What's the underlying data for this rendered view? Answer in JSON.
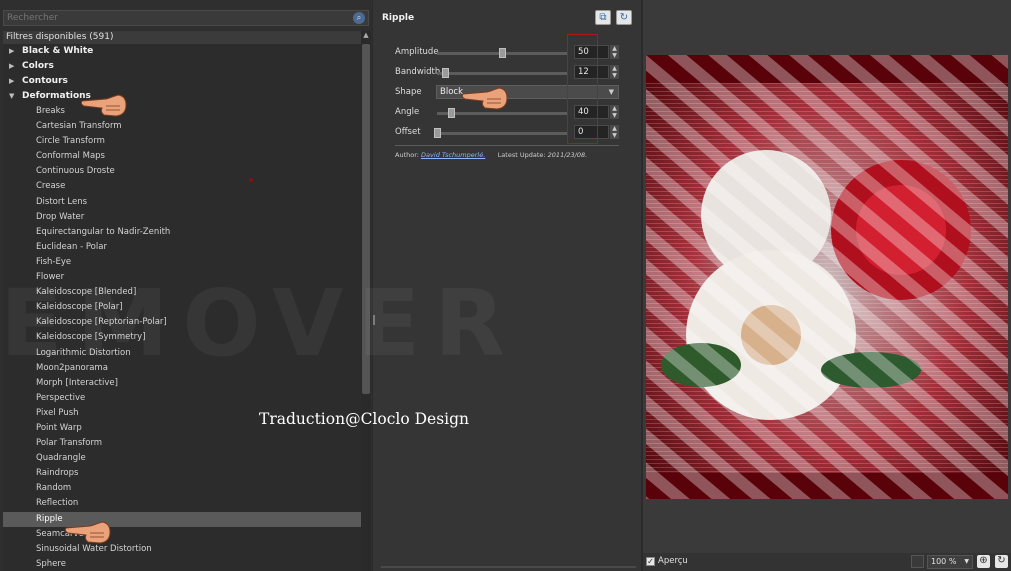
{
  "search": {
    "placeholder": "Rechercher"
  },
  "list": {
    "header": "Filtres disponibles (591)",
    "categories": [
      {
        "label": "Black & White",
        "expanded": false
      },
      {
        "label": "Colors",
        "expanded": false
      },
      {
        "label": "Contours",
        "expanded": false
      },
      {
        "label": "Deformations",
        "expanded": true
      }
    ],
    "items": [
      "Breaks",
      "Cartesian Transform",
      "Circle Transform",
      "Conformal Maps",
      "Continuous Droste",
      "Crease",
      "Distort Lens",
      "Drop Water",
      "Equirectangular to Nadir-Zenith",
      "Euclidean - Polar",
      "Fish-Eye",
      "Flower",
      "Kaleidoscope [Blended]",
      "Kaleidoscope [Polar]",
      "Kaleidoscope [Reptorian-Polar]",
      "Kaleidoscope [Symmetry]",
      "Logarithmic Distortion",
      "Moon2panorama",
      "Morph [Interactive]",
      "Perspective",
      "Pixel Push",
      "Point Warp",
      "Polar Transform",
      "Quadrangle",
      "Raindrops",
      "Random",
      "Reflection",
      "Ripple",
      "Seamcarve",
      "Sinusoidal Water Distortion",
      "Sphere"
    ],
    "selected": "Ripple"
  },
  "filter": {
    "title": "Ripple",
    "params": [
      {
        "label": "Amplitude",
        "value": "50",
        "level": 0.5
      },
      {
        "label": "Bandwidth",
        "value": "12",
        "level": 0.06
      },
      {
        "label": "Angle",
        "value": "40",
        "level": 0.11
      },
      {
        "label": "Offset",
        "value": "0",
        "level": 0.0
      }
    ],
    "shape": {
      "label": "Shape",
      "value": "Block"
    },
    "author_label": "Author:",
    "author_name": "David Tschumperlé.",
    "update_label": "Latest Update:",
    "update_date": "2011/23/08."
  },
  "status": {
    "apercu_label": "Aperçu",
    "zoom": "100 %"
  },
  "overlay": {
    "credit": "Traduction@Cloclo Design",
    "watermark": "EMOVER"
  },
  "icons": {
    "search": "search-icon",
    "copy": "copy-icon",
    "refresh": "refresh-icon",
    "pointer": "pointing-hand-icon"
  }
}
